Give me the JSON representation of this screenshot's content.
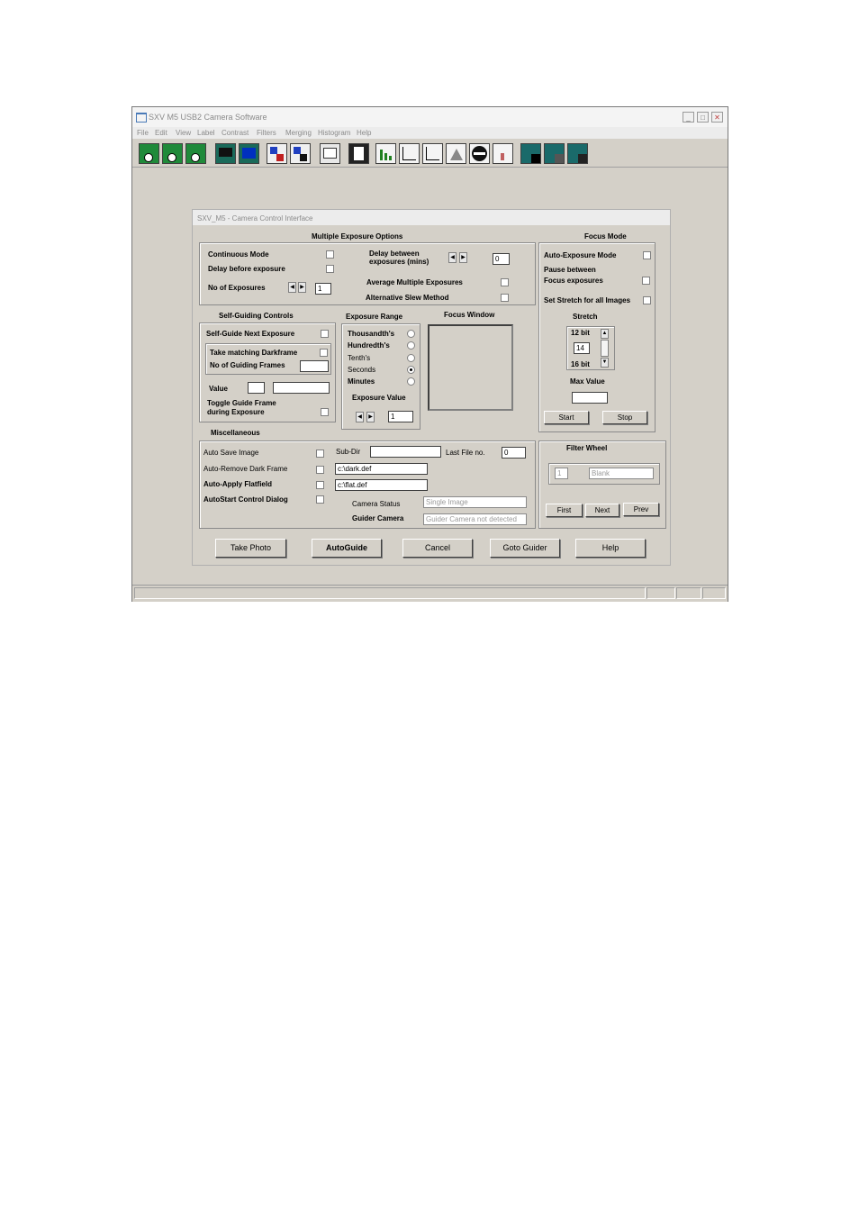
{
  "window": {
    "title": "SXV M5 USB2 Camera Software",
    "menu": [
      "File",
      "Edit",
      "View",
      "Label",
      "Contrast",
      "Filters",
      "Merging",
      "Histogram",
      "Help"
    ],
    "controls": {
      "minimize": "_",
      "maximize": "□",
      "close": "✕"
    }
  },
  "toolbar": {
    "buttons": [
      "camera-download-icon",
      "camera-download-icon",
      "camera-download-icon",
      "monitor-dark-icon",
      "monitor-blue-icon",
      "import-image-icon",
      "export-image-icon",
      "document-text-icon",
      "document-grid-icon",
      "histogram-icon",
      "curve-icon",
      "gamma-curve-icon",
      "peak-icon",
      "circle-filter-icon",
      "histogram-small-icon",
      "tile-icon",
      "tile-icon",
      "tile-icon"
    ]
  },
  "dialog": {
    "title": "SXV_M5  -  Camera Control Interface",
    "multiple_exposure": {
      "heading": "Multiple Exposure Options",
      "continuous_mode": "Continuous Mode",
      "delay_before": "Delay before exposure",
      "no_of_exposures": "No of Exposures",
      "no_of_exposures_value": "1",
      "delay_between_1": "Delay between",
      "delay_between_2": "exposures (mins)",
      "delay_between_value": "0",
      "average_multiple": "Average Multiple Exposures",
      "alt_slew": "Alternative Slew Method"
    },
    "focus_mode": {
      "heading": "Focus Mode",
      "auto_exposure": "Auto-Exposure Mode",
      "pause_1": "Pause between",
      "pause_2": "Focus exposures",
      "set_stretch": "Set Stretch for all Images",
      "stretch": "Stretch",
      "bit12": "12 bit",
      "bit_value": "14",
      "bit16": "16 bit",
      "max_value": "Max Value",
      "max_value_input": "",
      "start": "Start",
      "stop": "Stop"
    },
    "self_guiding": {
      "heading": "Self-Guiding Controls",
      "self_guide_next": "Self-Guide Next Exposure",
      "take_matching": "Take matching Darkframe",
      "no_guiding_frames": "No of Guiding Frames",
      "guiding_frames_value": "",
      "value": "Value",
      "value_input_1": "",
      "value_input_2": "",
      "toggle_1": "Toggle Guide Frame",
      "toggle_2": "during Exposure"
    },
    "exposure_range": {
      "heading": "Exposure Range",
      "options": [
        "Thousandth's",
        "Hundredth's",
        "Tenth's",
        "Seconds",
        "Minutes"
      ],
      "selected": "Seconds",
      "exposure_value_label": "Exposure Value",
      "exposure_value": "1"
    },
    "focus_window": {
      "heading": "Focus Window"
    },
    "misc": {
      "heading": "Miscellaneous",
      "auto_save": "Auto Save Image",
      "auto_remove_dark": "Auto-Remove Dark Frame",
      "auto_apply_flat": "Auto-Apply Flatfield",
      "autostart": "AutoStart Control Dialog",
      "sub_dir": "Sub-Dir",
      "sub_dir_value": "",
      "last_file_no": "Last File no.",
      "last_file_value": "0",
      "dark_file": "c:\\dark.def",
      "flat_file": "c:\\flat.def",
      "camera_status_label": "Camera Status",
      "camera_status": "Single Image",
      "guider_camera_label": "Guider Camera",
      "guider_camera": "Guider Camera not detected"
    },
    "filter_wheel": {
      "heading": "Filter Wheel",
      "position": "1",
      "filter_name": "Blank",
      "first": "First",
      "next": "Next",
      "prev": "Prev"
    },
    "buttons": {
      "take_photo": "Take Photo",
      "autoguide": "AutoGuide",
      "cancel": "Cancel",
      "goto_guider": "Goto Guider",
      "help": "Help"
    }
  }
}
